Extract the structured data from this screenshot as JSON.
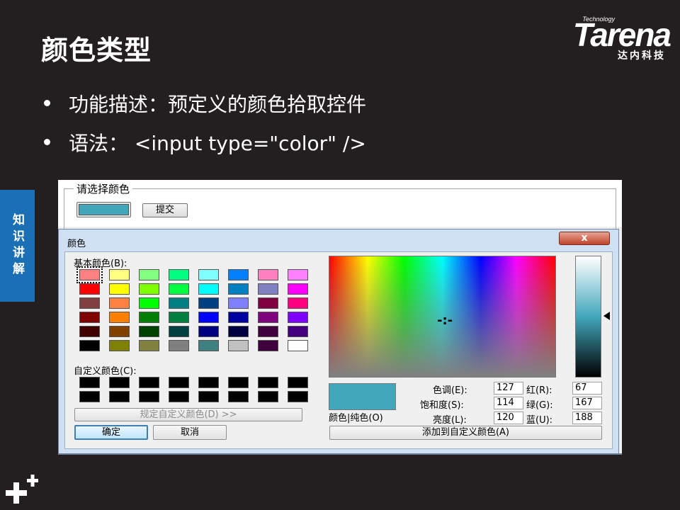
{
  "slide": {
    "title": "颜色类型",
    "bullets": [
      "功能描述：预定义的颜色拾取控件",
      "语法： <input type=\"color\" />"
    ],
    "side_tab": "知识讲解"
  },
  "logo": {
    "small": "Technology",
    "main": "Tarena",
    "sub": "达内科技"
  },
  "form": {
    "legend": "请选择颜色",
    "selected_color": "#43a7bc",
    "submit_label": "提交"
  },
  "dialog": {
    "title": "颜色",
    "close_label": "x",
    "basic_colors_label": "基本颜色(B):",
    "custom_colors_label": "自定义颜色(C):",
    "define_custom_label": "规定自定义颜色(D) >>",
    "ok_label": "确定",
    "cancel_label": "取消",
    "crosshair": "-:-",
    "preview_label": "颜色|纯色(O)",
    "add_custom_label": "添加到自定义颜色(A)",
    "fields": {
      "hue_label": "色调(E):",
      "hue": "127",
      "sat_label": "饱和度(S):",
      "sat": "114",
      "lum_label": "亮度(L):",
      "lum": "120",
      "red_label": "红(R):",
      "red": "67",
      "green_label": "绿(G):",
      "green": "167",
      "blue_label": "蓝(U):",
      "blue": "188"
    },
    "basic_colors": [
      [
        "#ff8080",
        "#ffff80",
        "#80ff80",
        "#00ff80",
        "#80ffff",
        "#0080ff",
        "#ff80c0",
        "#ff80ff"
      ],
      [
        "#ff0000",
        "#ffff00",
        "#80ff00",
        "#00ff40",
        "#00ffff",
        "#0080c0",
        "#8080c0",
        "#ff00ff"
      ],
      [
        "#804040",
        "#ff8040",
        "#00ff00",
        "#008080",
        "#004080",
        "#8080ff",
        "#800040",
        "#ff0080"
      ],
      [
        "#800000",
        "#ff8000",
        "#008000",
        "#008040",
        "#0000ff",
        "#0000a0",
        "#800080",
        "#8000ff"
      ],
      [
        "#400000",
        "#804000",
        "#004000",
        "#004040",
        "#000080",
        "#000040",
        "#400040",
        "#400080"
      ],
      [
        "#000000",
        "#808000",
        "#808040",
        "#808080",
        "#408080",
        "#c0c0c0",
        "#400040",
        "#ffffff"
      ]
    ],
    "custom_colors": [
      [
        "#000000",
        "#000000",
        "#000000",
        "#000000",
        "#000000",
        "#000000",
        "#000000",
        "#000000"
      ],
      [
        "#000000",
        "#000000",
        "#000000",
        "#000000",
        "#000000",
        "#000000",
        "#000000",
        "#000000"
      ]
    ]
  }
}
